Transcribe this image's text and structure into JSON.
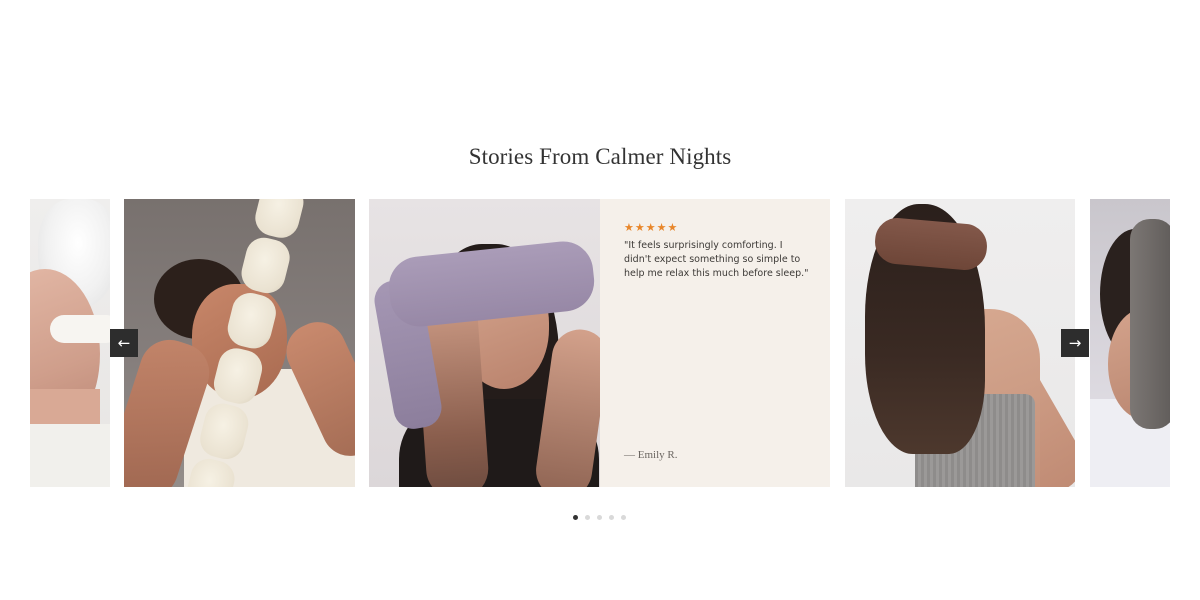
{
  "section": {
    "title": "Stories From Calmer Nights"
  },
  "carousel": {
    "prev_icon": "←",
    "next_icon": "→",
    "review": {
      "stars": "★★★★★",
      "rating": 5,
      "star_color": "#e8862a",
      "quote": "\"It feels surprisingly comforting. I didn't expect something so simple to help me relax this much before sleep.\"",
      "author": "— Emily R."
    },
    "slides": [
      {
        "image": "woman-sleeping-white-eye-mask"
      },
      {
        "image": "man-holding-cream-pillow"
      },
      {
        "image": "woman-lavender-eye-mask"
      },
      {
        "image": "review-card"
      },
      {
        "image": "woman-brown-eye-mask-back"
      },
      {
        "image": "woman-gray-eye-mask"
      }
    ],
    "dots": {
      "count": 5,
      "active_index": 0
    }
  },
  "colors": {
    "accent_dark": "#2d2d2d",
    "quote_background": "#f5f0ea",
    "dot_active": "#333333",
    "dot_inactive": "#d9d9d9"
  }
}
